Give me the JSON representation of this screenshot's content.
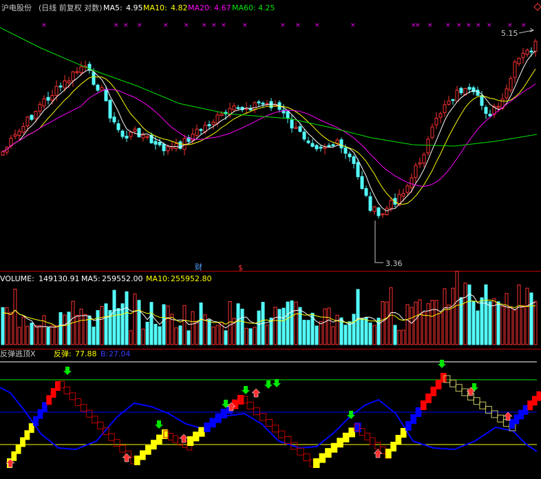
{
  "stock": {
    "name": "沪电股份",
    "period_label": "(日线 前复权 对数)"
  },
  "price_panel": {
    "ma5_label": "MA5:",
    "ma5": "4.95",
    "ma10_label": "MA10:",
    "ma10": "4.82",
    "ma20_label": "MA20:",
    "ma20": "4.67",
    "ma60_label": "MA60:",
    "ma60": "4.25",
    "high_marker": "5.15",
    "low_marker": "3.36",
    "finance_badge": "财",
    "dollar_badge": "$"
  },
  "volume_panel": {
    "label": "VOLUME:",
    "value": "149130.91",
    "ma5_label": "MA5:",
    "ma5": "259552.00",
    "ma10_label": "MA10:",
    "ma10": "255952.80"
  },
  "indicator_panel": {
    "name": "反弹逃顶X",
    "rebound_label": "反弹:",
    "rebound": "77.88",
    "b_label": "B:",
    "b": "27.04"
  },
  "colors": {
    "up": "#ff3232",
    "down": "#54fcfc",
    "ma5": "#ffffff",
    "ma10": "#ffff00",
    "ma20": "#ff00ff",
    "ma60": "#00e600",
    "axis": "#c00000",
    "blue": "#0000ff",
    "red": "#ff0000",
    "yellow": "#ffff00"
  }
}
